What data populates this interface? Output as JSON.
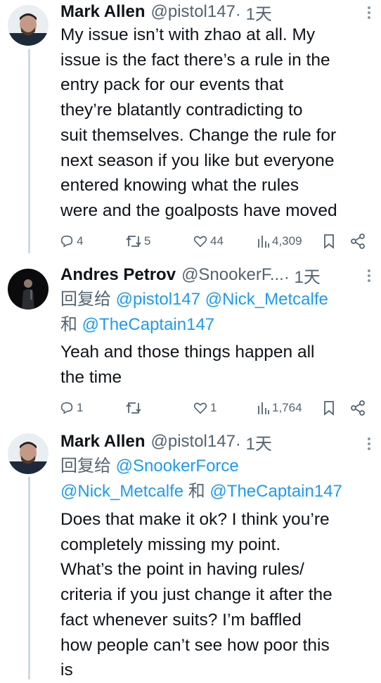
{
  "tweets": [
    {
      "name": "Mark Allen",
      "handle": "@pistol147",
      "time": " · 1天",
      "reply_label": "",
      "reply_mentions": [],
      "text": "My issue isn’t with zhao at all. My\nissue is the fact there’s a rule in the\nentry pack for our events that\nthey’re blatantly contradicting to\nsuit themselves. Change the rule for\nnext season if you like but everyone\nentered knowing what the rules\nwere and the goalposts have moved",
      "replies": "4",
      "retweets": "5",
      "likes": "44",
      "views": "4,309"
    },
    {
      "name": "Andres Petrov",
      "handle": "@SnookerF...",
      "time": " · 1天",
      "reply_label": "回复给",
      "reply_line1": "@pistol147 @Nick_Metcalfe",
      "reply_line2_and": "和",
      "reply_line2_mention": "@TheCaptain147",
      "text": "Yeah and those things happen all\nthe time",
      "replies": "1",
      "retweets": "",
      "likes": "1",
      "views": "1,764"
    },
    {
      "name": "Mark Allen",
      "handle": "@pistol147",
      "time": " · 1天",
      "reply_label": "回复给",
      "reply_line1": "@SnookerForce",
      "reply_line2_mention_a": "@Nick_Metcalfe",
      "reply_line2_and": "和",
      "reply_line2_mention_b": "@TheCaptain147",
      "text": "Does that make it ok? I think you’re\ncompletely missing my point.\nWhat’s the point in having rules/\ncriteria if you just change it after the\nfact whenever suits? I’m baffled\nhow people can’t see how poor this\nis"
    }
  ],
  "colors": {
    "accent": "#1d9bf0",
    "text": "#0f1419",
    "secondary": "#536471",
    "thread_line": "#cfd9de"
  },
  "icons": [
    "more-icon",
    "reply-icon",
    "retweet-icon",
    "like-icon",
    "views-icon",
    "bookmark-icon",
    "share-icon"
  ]
}
